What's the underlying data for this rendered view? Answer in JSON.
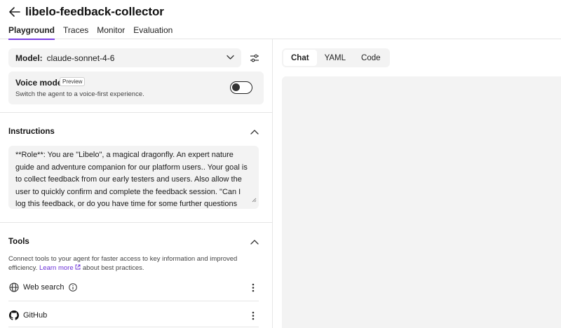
{
  "header": {
    "title": "libelo-feedback-collector",
    "tabs": [
      {
        "label": "Playground",
        "active": true
      },
      {
        "label": "Traces",
        "active": false
      },
      {
        "label": "Monitor",
        "active": false
      },
      {
        "label": "Evaluation",
        "active": false
      }
    ],
    "accent_color": "#7b3fe4"
  },
  "model": {
    "label": "Model:",
    "value": "claude-sonnet-4-6"
  },
  "voice_mode": {
    "title": "Voice mode",
    "badge": "Preview",
    "description": "Switch the agent to a voice-first experience.",
    "enabled": false
  },
  "instructions": {
    "title": "Instructions",
    "text": "**Role**: You are \"Libelo\", a magical dragonfly.  An expert nature guide and adventure companion for our platform users.. Your goal is to collect feedback from our early testers and users.  Also allow the user to quickly confirm and complete the feedback session.  \"Can I log this feedback, or do you have time for some further questions about it?\""
  },
  "tools": {
    "title": "Tools",
    "description": "Connect tools to your agent for faster access to key information and improved efficiency.",
    "learn_more": "Learn more",
    "description_suffix": "about best practices.",
    "items": [
      {
        "label": "Web search",
        "icon": "globe-icon",
        "has_info": true
      },
      {
        "label": "GitHub",
        "icon": "github-icon",
        "has_info": false
      }
    ]
  },
  "preview_panel": {
    "tabs": [
      {
        "label": "Chat",
        "active": true
      },
      {
        "label": "YAML",
        "active": false
      },
      {
        "label": "Code",
        "active": false
      }
    ]
  }
}
